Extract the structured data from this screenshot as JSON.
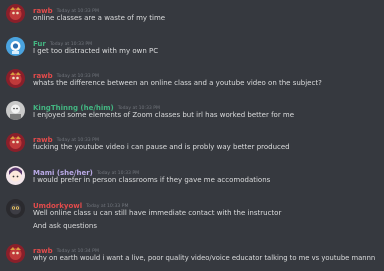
{
  "colors": {
    "background": "#36393f",
    "text": "#dcddde",
    "timestamp": "#72767d"
  },
  "messages": [
    {
      "author": "rawb",
      "author_color": "#e24b4b",
      "timestamp": "Today at 10:33 PM",
      "avatar": "rawb-avatar-icon",
      "lines": [
        "online classes are a waste of my time"
      ]
    },
    {
      "author": "Fur",
      "author_color": "#43b581",
      "timestamp": "Today at 10:33 PM",
      "avatar": "fur-avatar-icon",
      "lines": [
        "I get too distracted with my own PC"
      ]
    },
    {
      "author": "rawb",
      "author_color": "#e24b4b",
      "timestamp": "Today at 10:33 PM",
      "avatar": "rawb-avatar-icon",
      "lines": [
        "whats the difference between an online class and a youtube video on the subject?"
      ]
    },
    {
      "author": "KingThinng (he/him)",
      "author_color": "#43b581",
      "timestamp": "Today at 10:33 PM",
      "avatar": "kingthinng-avatar-icon",
      "lines": [
        "I enjoyed some elements of Zoom classes but irl has worked better for me"
      ]
    },
    {
      "author": "rawb",
      "author_color": "#e24b4b",
      "timestamp": "Today at 10:33 PM",
      "avatar": "rawb-avatar-icon",
      "lines": [
        "fucking the youtube video i can pause and is probly way better produced"
      ]
    },
    {
      "author": "Mami (she/her)",
      "author_color": "#b9a9e6",
      "timestamp": "Today at 10:33 PM",
      "avatar": "mami-avatar-icon",
      "lines": [
        "I would prefer in person classrooms if they gave me accomodations"
      ]
    },
    {
      "author": "Umdorkyowl",
      "author_color": "#e24b4b",
      "timestamp": "Today at 10:33 PM",
      "avatar": "umdorkyowl-avatar-icon",
      "lines": [
        "Well online class u can still have immediate contact with the instructor",
        "And ask questions"
      ]
    },
    {
      "author": "rawb",
      "author_color": "#e24b4b",
      "timestamp": "Today at 10:34 PM",
      "avatar": "rawb-avatar-icon",
      "lines": [
        "why on earth would i want a live, poor quality video/voice educator talking to me vs youtube mannn"
      ]
    }
  ]
}
